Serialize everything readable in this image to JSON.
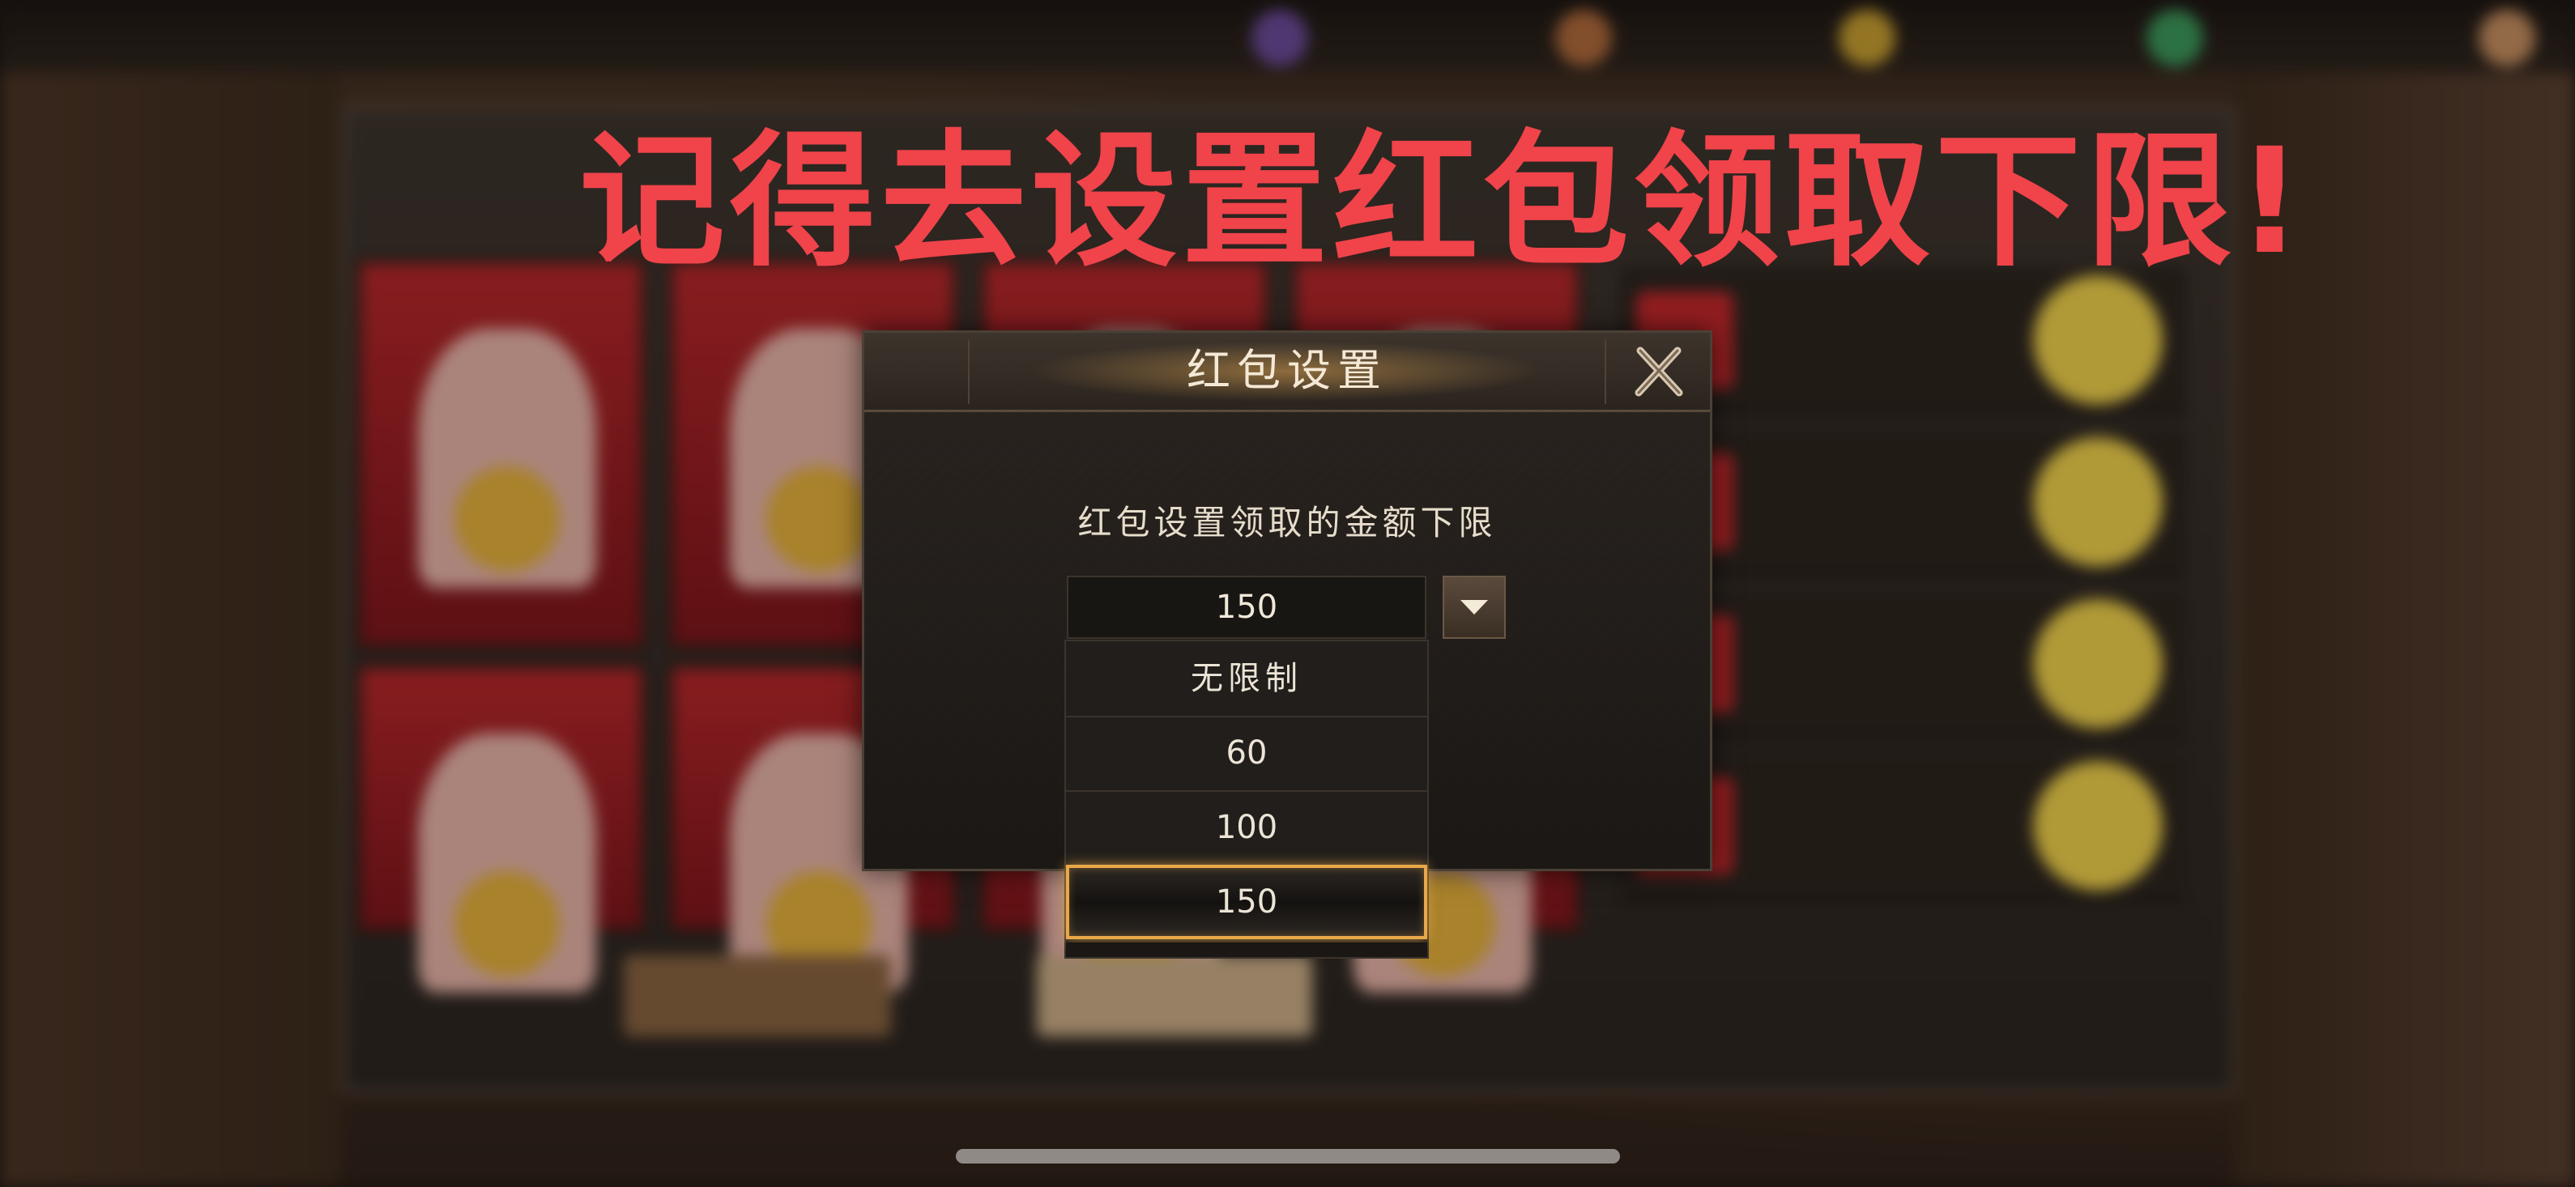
{
  "overlay": {
    "headline": "记得去设置红包领取下限!"
  },
  "dialog": {
    "title": "红包设置",
    "prompt": "红包设置领取的金额下限",
    "selected_value": "150",
    "options": [
      "无限制",
      "60",
      "100",
      "150"
    ],
    "selected_index": 3,
    "close_icon": "close-icon",
    "dropdown_icon": "chevron-down-icon"
  },
  "colors": {
    "headline": "#f0434a",
    "selection_border": "#e9a849",
    "dialog_bg": "#1f1c19"
  }
}
